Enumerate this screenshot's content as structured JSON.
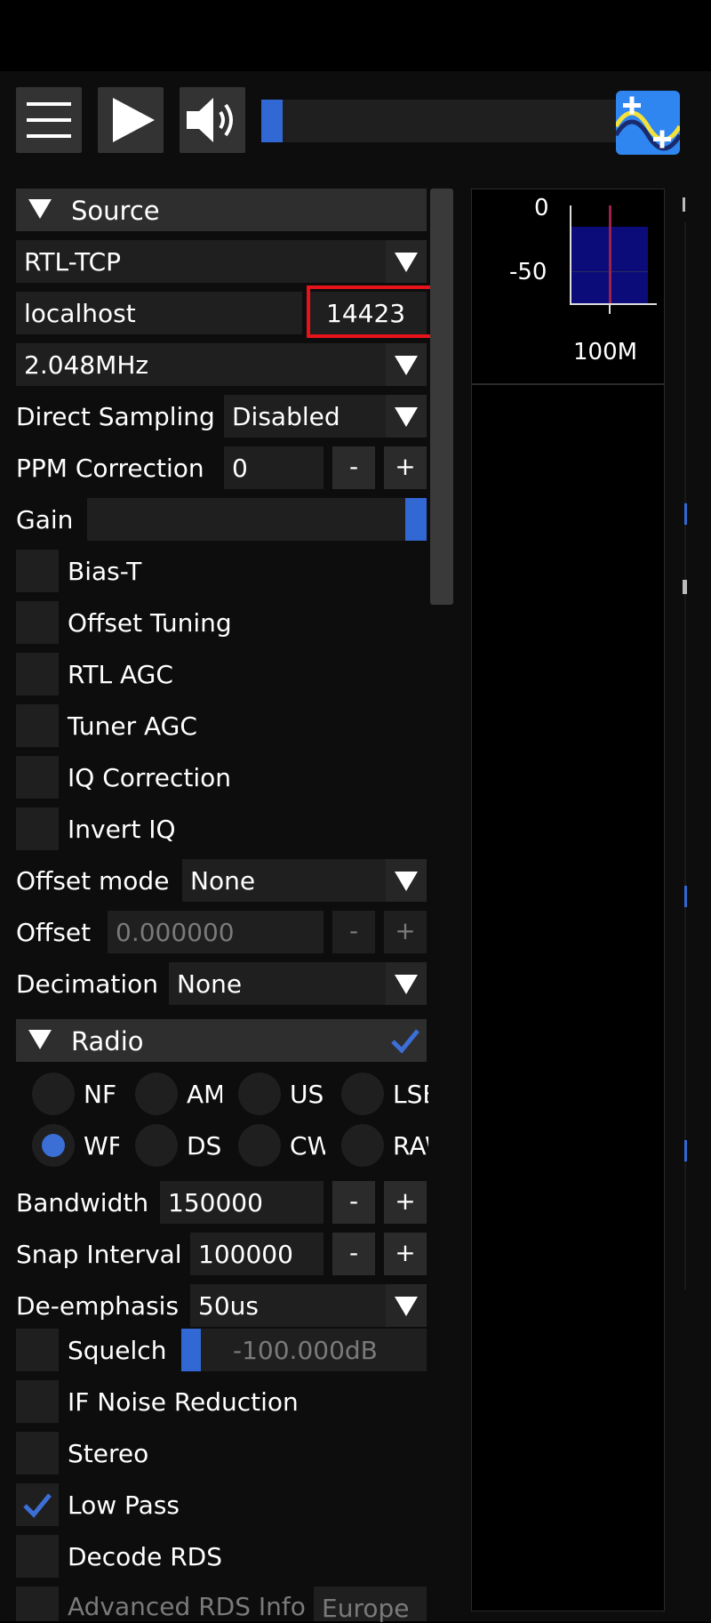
{
  "toolbar": {
    "menu_icon": "hamburger-menu-icon",
    "play_icon": "play-icon",
    "volume_icon": "speaker-volume-icon",
    "volume_level": 0.0,
    "logo_icon": "sdrpp-logo-icon"
  },
  "source": {
    "title": "Source",
    "source_type": "RTL-TCP",
    "host": "localhost",
    "port": "14423",
    "sample_rate": "2.048MHz",
    "direct_sampling_label": "Direct Sampling",
    "direct_sampling_value": "Disabled",
    "ppm_label": "PPM Correction",
    "ppm_value": "0",
    "minus": "-",
    "plus": "+",
    "gain_label": "Gain",
    "gain_level": 1.0,
    "checkboxes": [
      {
        "label": "Bias-T",
        "checked": false
      },
      {
        "label": "Offset Tuning",
        "checked": false
      },
      {
        "label": "RTL AGC",
        "checked": false
      },
      {
        "label": "Tuner AGC",
        "checked": false
      },
      {
        "label": "IQ Correction",
        "checked": false
      },
      {
        "label": "Invert IQ",
        "checked": false
      }
    ],
    "offset_mode_label": "Offset mode",
    "offset_mode_value": "None",
    "offset_label": "Offset",
    "offset_value": "0.000000",
    "decimation_label": "Decimation",
    "decimation_value": "None"
  },
  "radio": {
    "title": "Radio",
    "enabled": true,
    "modes_row1": [
      "NF",
      "AM",
      "USB",
      "LSB"
    ],
    "modes_row2": [
      "WF",
      "DS",
      "CW",
      "RAW"
    ],
    "selected_mode": "WF",
    "bandwidth_label": "Bandwidth",
    "bandwidth_value": "150000",
    "snap_label": "Snap Interval",
    "snap_value": "100000",
    "deemph_label": "De-emphasis",
    "deemph_value": "50us",
    "squelch_label": "Squelch",
    "squelch_value": "-100.000dB",
    "checkboxes": [
      {
        "label": "IF Noise Reduction",
        "checked": false
      },
      {
        "label": "Stereo",
        "checked": false
      },
      {
        "label": "Low Pass",
        "checked": true
      },
      {
        "label": "Decode RDS",
        "checked": false
      }
    ],
    "advanced_rds_label": "Advanced RDS Info",
    "region_value": "Europe"
  },
  "fft": {
    "tick_0": "0",
    "tick_50": "-50",
    "freq_label": "100M"
  },
  "colors": {
    "accent": "#3268d4",
    "highlight": "#e8131a",
    "logo_bg": "#2f86f0"
  }
}
